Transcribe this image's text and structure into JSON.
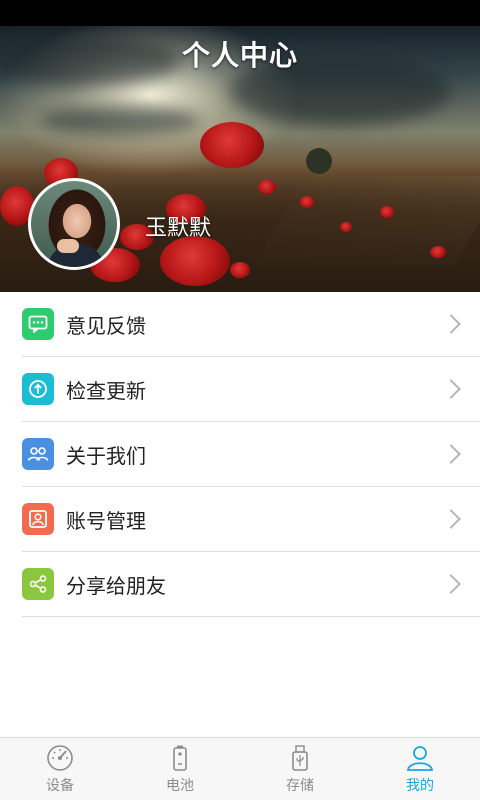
{
  "header": {
    "title": "个人中心"
  },
  "profile": {
    "name": "玉默默"
  },
  "menu": {
    "items": [
      {
        "label": "意见反馈",
        "icon": "feedback-icon",
        "color": "#2ecc71"
      },
      {
        "label": "检查更新",
        "icon": "update-icon",
        "color": "#1cbcd4"
      },
      {
        "label": "关于我们",
        "icon": "about-icon",
        "color": "#4a90e2"
      },
      {
        "label": "账号管理",
        "icon": "account-icon",
        "color": "#f26b4e"
      },
      {
        "label": "分享给朋友",
        "icon": "share-icon",
        "color": "#8cc63f"
      }
    ]
  },
  "tabbar": {
    "tabs": [
      {
        "label": "设备",
        "icon": "gauge-icon",
        "active": false
      },
      {
        "label": "电池",
        "icon": "battery-icon",
        "active": false
      },
      {
        "label": "存储",
        "icon": "usb-storage-icon",
        "active": false
      },
      {
        "label": "我的",
        "icon": "person-icon",
        "active": true
      }
    ],
    "active_color": "#1aa7e3",
    "inactive_color": "#8c8c8c"
  }
}
